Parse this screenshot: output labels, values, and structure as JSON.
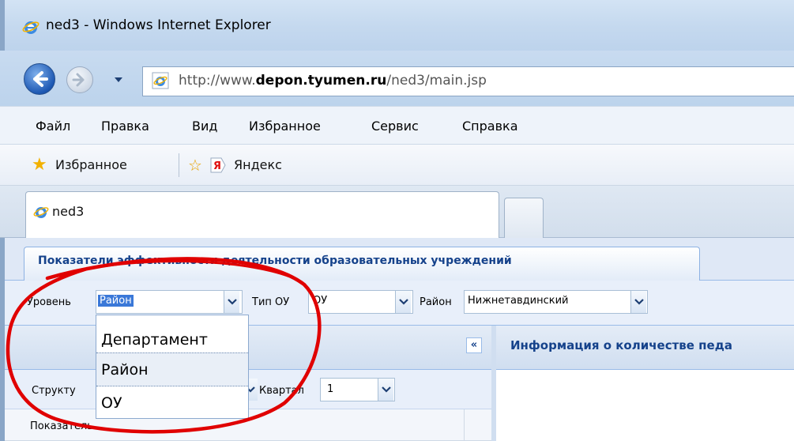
{
  "window": {
    "title": "ned3 - Windows Internet Explorer"
  },
  "address_bar": {
    "prefix": "http://www.",
    "domain": "depon.tyumen.ru",
    "path": "/ned3/main.jsp"
  },
  "menu": [
    "Файл",
    "Правка",
    "Вид",
    "Избранное",
    "Сервис",
    "Справка"
  ],
  "favorites_bar": {
    "favorites_label": "Избранное",
    "yandex_label": "Яндекс"
  },
  "browser_tab": {
    "label": "ned3"
  },
  "app": {
    "tab_label": "Показатели эффективности деятельности образовательных учреждений",
    "filters": {
      "level_label": "Уровень",
      "level_value": "Район",
      "type_label": "Тип ОУ",
      "type_value": "ОУ",
      "district_label": "Район",
      "district_value": "Нижнетавдинский"
    },
    "level_options": [
      "Департамент",
      "Район",
      "ОУ"
    ],
    "structure_label": "Структу",
    "quarter_label": "Квартал",
    "quarter_value": "1",
    "collapse_symbol": "«",
    "panel_title": "Информация о количестве педа",
    "column_header": "Показатель"
  },
  "colors": {
    "annotation": "#e00000",
    "selection": "#3a78d8",
    "app_blue": "#15428b"
  }
}
